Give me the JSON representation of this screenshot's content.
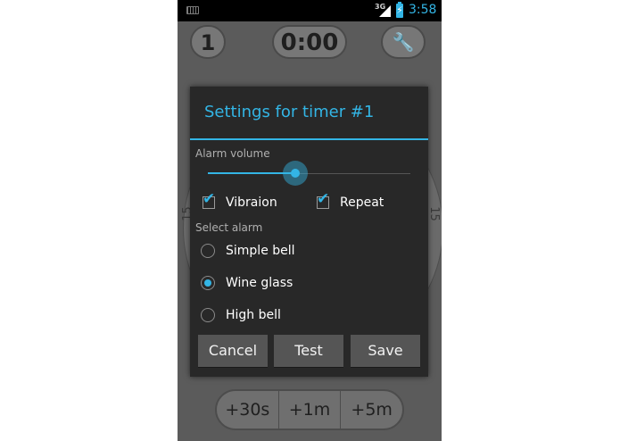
{
  "statusbar": {
    "network": "3G",
    "battery_glyph": "⚡",
    "time": "3:58",
    "icons": [
      "keyboard-icon",
      "signal-icon",
      "battery-icon"
    ]
  },
  "background": {
    "timer_count": "1",
    "timer_time": "0:00",
    "settings_glyph": "🔧",
    "dial_mark_left": "15",
    "dial_mark_right": "15",
    "add_buttons": [
      "+30s",
      "+1m",
      "+5m"
    ]
  },
  "dialog": {
    "title": "Settings for timer #1",
    "volume_label": "Alarm volume",
    "volume": 0.43,
    "checks": [
      {
        "label": "Vibraion",
        "checked": true
      },
      {
        "label": "Repeat",
        "checked": true
      }
    ],
    "select_label": "Select alarm",
    "alarms": [
      {
        "label": "Simple bell",
        "selected": false
      },
      {
        "label": "Wine glass",
        "selected": true
      },
      {
        "label": "High bell",
        "selected": false
      }
    ],
    "buttons": {
      "cancel": "Cancel",
      "test": "Test",
      "save": "Save"
    }
  },
  "colors": {
    "accent": "#33b5e5",
    "dialog_bg": "#282828",
    "button_bg": "#555555"
  }
}
